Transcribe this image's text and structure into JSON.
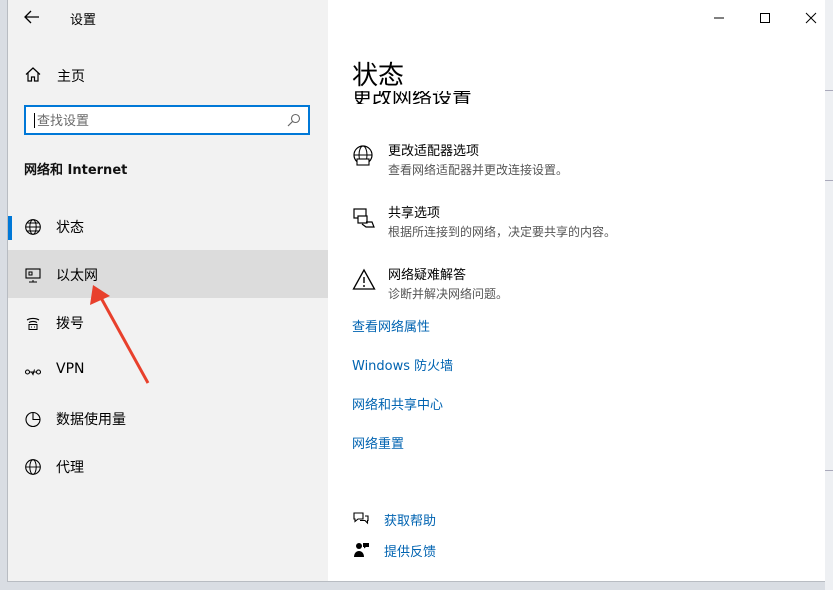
{
  "window": {
    "title": "设置"
  },
  "sidebar": {
    "home_label": "主页",
    "search_placeholder": "查找设置",
    "section_title": "网络和 Internet",
    "items": [
      {
        "label": "状态",
        "icon": "globe-icon",
        "selected": false
      },
      {
        "label": "以太网",
        "icon": "ethernet-icon",
        "selected": true
      },
      {
        "label": "拨号",
        "icon": "dialup-icon",
        "selected": false
      },
      {
        "label": "VPN",
        "icon": "vpn-icon",
        "selected": false
      },
      {
        "label": "数据使用量",
        "icon": "data-usage-icon",
        "selected": false
      },
      {
        "label": "代理",
        "icon": "globe-icon",
        "selected": false
      }
    ]
  },
  "main": {
    "title": "状态",
    "subheading_clipped": "更改网络设置",
    "options": [
      {
        "title": "更改适配器选项",
        "desc": "查看网络适配器并更改连接设置。",
        "icon": "adapter-globe-icon"
      },
      {
        "title": "共享选项",
        "desc": "根据所连接到的网络，决定要共享的内容。",
        "icon": "sharing-icon"
      },
      {
        "title": "网络疑难解答",
        "desc": "诊断并解决网络问题。",
        "icon": "warning-triangle-icon"
      }
    ],
    "links": [
      "查看网络属性",
      "Windows 防火墙",
      "网络和共享中心",
      "网络重置"
    ],
    "help": [
      {
        "label": "获取帮助",
        "icon": "help-chat-icon"
      },
      {
        "label": "提供反馈",
        "icon": "feedback-icon"
      }
    ]
  },
  "colors": {
    "accent": "#0078d7",
    "link": "#0063b1",
    "sidebar_bg": "#f2f2f2",
    "selected_bg": "#dcdcdc",
    "annotation_arrow": "#e8402c"
  }
}
